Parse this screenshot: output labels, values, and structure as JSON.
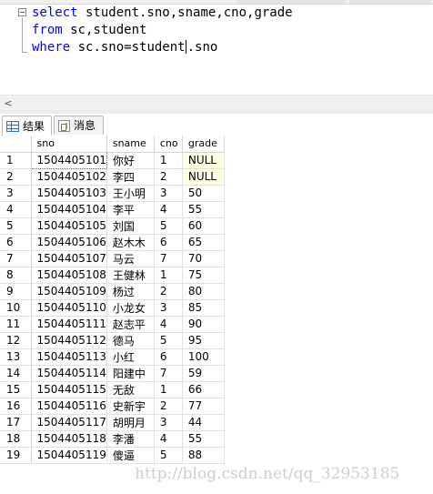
{
  "editor": {
    "lines": [
      {
        "keyword": "select",
        "text": " student.sno,sname,cno,grade"
      },
      {
        "keyword": "from",
        "text": " sc,student"
      },
      {
        "keyword": "where",
        "text_before_cursor": " sc.sno=student",
        "text_after_cursor": ".sno"
      }
    ]
  },
  "scrollbar": {
    "left_arrow": "<"
  },
  "tabs": {
    "results": "结果",
    "messages": "消息"
  },
  "grid": {
    "columns": [
      "sno",
      "sname",
      "cno",
      "grade"
    ],
    "rows": [
      {
        "n": "1",
        "sno": "1504405101",
        "sname": "你好",
        "cno": "1",
        "grade": "NULL"
      },
      {
        "n": "2",
        "sno": "1504405102",
        "sname": "李四",
        "cno": "2",
        "grade": "NULL"
      },
      {
        "n": "3",
        "sno": "1504405103",
        "sname": "王小明",
        "cno": "3",
        "grade": "50"
      },
      {
        "n": "4",
        "sno": "1504405104",
        "sname": "李平",
        "cno": "4",
        "grade": "55"
      },
      {
        "n": "5",
        "sno": "1504405105",
        "sname": "刘国",
        "cno": "5",
        "grade": "60"
      },
      {
        "n": "6",
        "sno": "1504405106",
        "sname": "赵木木",
        "cno": "6",
        "grade": "65"
      },
      {
        "n": "7",
        "sno": "1504405107",
        "sname": "马云",
        "cno": "7",
        "grade": "70"
      },
      {
        "n": "8",
        "sno": "1504405108",
        "sname": "王健林",
        "cno": "1",
        "grade": "75"
      },
      {
        "n": "9",
        "sno": "1504405109",
        "sname": "杨过",
        "cno": "2",
        "grade": "80"
      },
      {
        "n": "10",
        "sno": "1504405110",
        "sname": "小龙女",
        "cno": "3",
        "grade": "85"
      },
      {
        "n": "11",
        "sno": "1504405111",
        "sname": "赵志平",
        "cno": "4",
        "grade": "90"
      },
      {
        "n": "12",
        "sno": "1504405112",
        "sname": "德马",
        "cno": "5",
        "grade": "95"
      },
      {
        "n": "13",
        "sno": "1504405113",
        "sname": "小红",
        "cno": "6",
        "grade": "100"
      },
      {
        "n": "14",
        "sno": "1504405114",
        "sname": "阳建中",
        "cno": "7",
        "grade": "59"
      },
      {
        "n": "15",
        "sno": "1504405115",
        "sname": "无敌",
        "cno": "1",
        "grade": "66"
      },
      {
        "n": "16",
        "sno": "1504405116",
        "sname": "史新宇",
        "cno": "2",
        "grade": "77"
      },
      {
        "n": "17",
        "sno": "1504405117",
        "sname": "胡明月",
        "cno": "3",
        "grade": "44"
      },
      {
        "n": "18",
        "sno": "1504405118",
        "sname": "李潘",
        "cno": "4",
        "grade": "55"
      },
      {
        "n": "19",
        "sno": "1504405119",
        "sname": "傻逼",
        "cno": "5",
        "grade": "88"
      }
    ],
    "null_color": "#ffffe1"
  },
  "watermark": "http://blog.csdn.net/qq_32953185",
  "colors": {
    "keyword": "#0000ff",
    "editor_bg": "#ffffff"
  }
}
